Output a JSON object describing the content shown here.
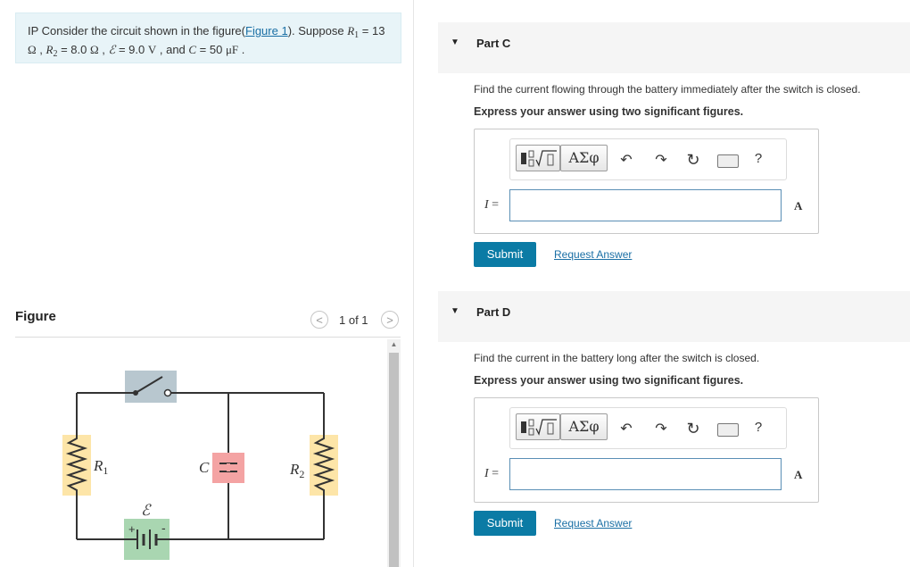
{
  "problem": {
    "prefix": "IP Consider the circuit shown in the figure(",
    "figure_link": "Figure 1",
    "suffix": "). Suppose ",
    "r1_sym": "R",
    "r1_sub": "1",
    "r1_val": " = 13",
    "ohm": "Ω",
    "r2_sym": "R",
    "r2_sub": "2",
    "r2_val": " = 8.0 ",
    "emf_sym": "ℰ",
    "emf_val": " = 9.0 ",
    "volt": "V",
    "c_sym": "C",
    "c_val": " = 50 ",
    "microfarad": "μF"
  },
  "figure": {
    "title": "Figure",
    "pager": "1 of 1",
    "prev_icon": "<",
    "next_icon": ">",
    "labels": {
      "r1": "R",
      "r1_sub": "1",
      "r2": "R",
      "r2_sub": "2",
      "c": "C",
      "emf": "ℰ",
      "plus": "+",
      "minus": "-"
    }
  },
  "parts": [
    {
      "label": "Part C",
      "question": "Find the current flowing through the battery immediately after the switch is closed.",
      "instruction": "Express your answer using two significant figures.",
      "var_label": "I",
      "equals": " =",
      "unit": "A",
      "submit": "Submit",
      "request": "Request Answer"
    },
    {
      "label": "Part D",
      "question": "Find the current in the battery long after the switch is closed.",
      "instruction": "Express your answer using two significant figures.",
      "var_label": "I",
      "equals": " =",
      "unit": "A",
      "submit": "Submit",
      "request": "Request Answer"
    }
  ],
  "toolbar": {
    "templates_icon": "fraction-sqrt-template-icon",
    "greek_label": "ΑΣφ",
    "undo_icon": "↶",
    "redo_icon": "↷",
    "reset_icon": "↻",
    "keyboard_icon": "keyboard-icon",
    "help_label": "?"
  },
  "colors": {
    "accent": "#0b7ba5",
    "problem_bg": "#e8f4f8",
    "resistor": "#fde5a8",
    "capacitor": "#f4a3a3",
    "battery": "#a9d6b1",
    "switch": "#b8c7cf"
  }
}
